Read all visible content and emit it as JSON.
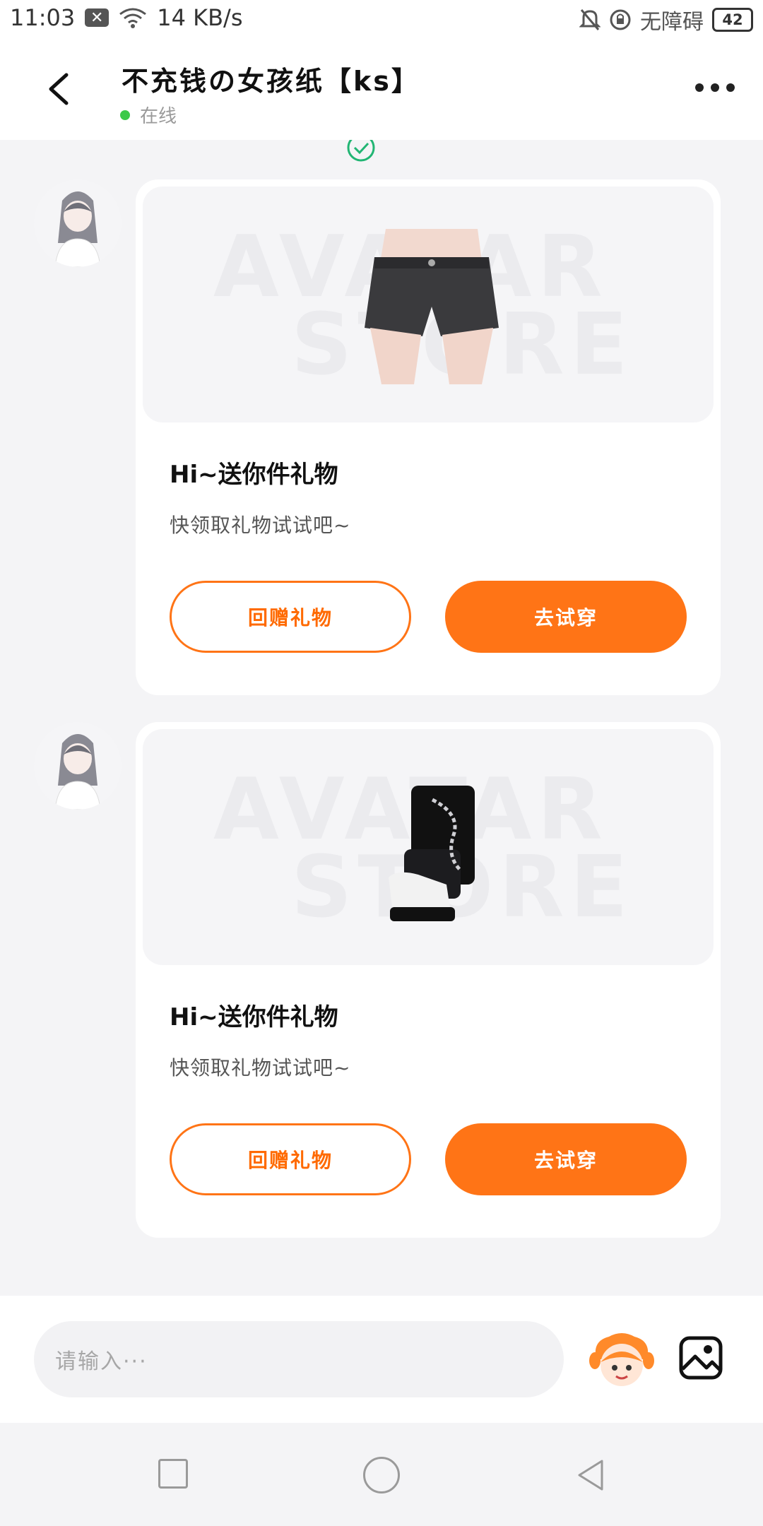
{
  "status_bar": {
    "time": "11:03",
    "notification_icon": "close-notification-icon",
    "network_speed": "14 KB/s",
    "accessibility": "无障碍",
    "battery": "42"
  },
  "header": {
    "title": "不充钱の女孩纸【ks】",
    "status": "在线",
    "back_icon": "chevron-left-icon",
    "more_icon": "more-dots-icon"
  },
  "messages": [
    {
      "item_name": "black denim shorts",
      "watermark_line1": "AVATAR",
      "watermark_line2": "STORE",
      "title": "Hi~送你件礼物",
      "subtitle": "快领取礼物试试吧~",
      "return_gift_label": "回赠礼物",
      "try_on_label": "去试穿"
    },
    {
      "item_name": "black chain boots",
      "watermark_line1": "AVATAR",
      "watermark_line2": "STORE",
      "title": "Hi~送你件礼物",
      "subtitle": "快领取礼物试试吧~",
      "return_gift_label": "回赠礼物",
      "try_on_label": "去试穿"
    }
  ],
  "input_bar": {
    "placeholder": "请输入···"
  },
  "colors": {
    "accent": "#ff7416",
    "online": "#3cc94a",
    "background": "#f4f4f6"
  }
}
